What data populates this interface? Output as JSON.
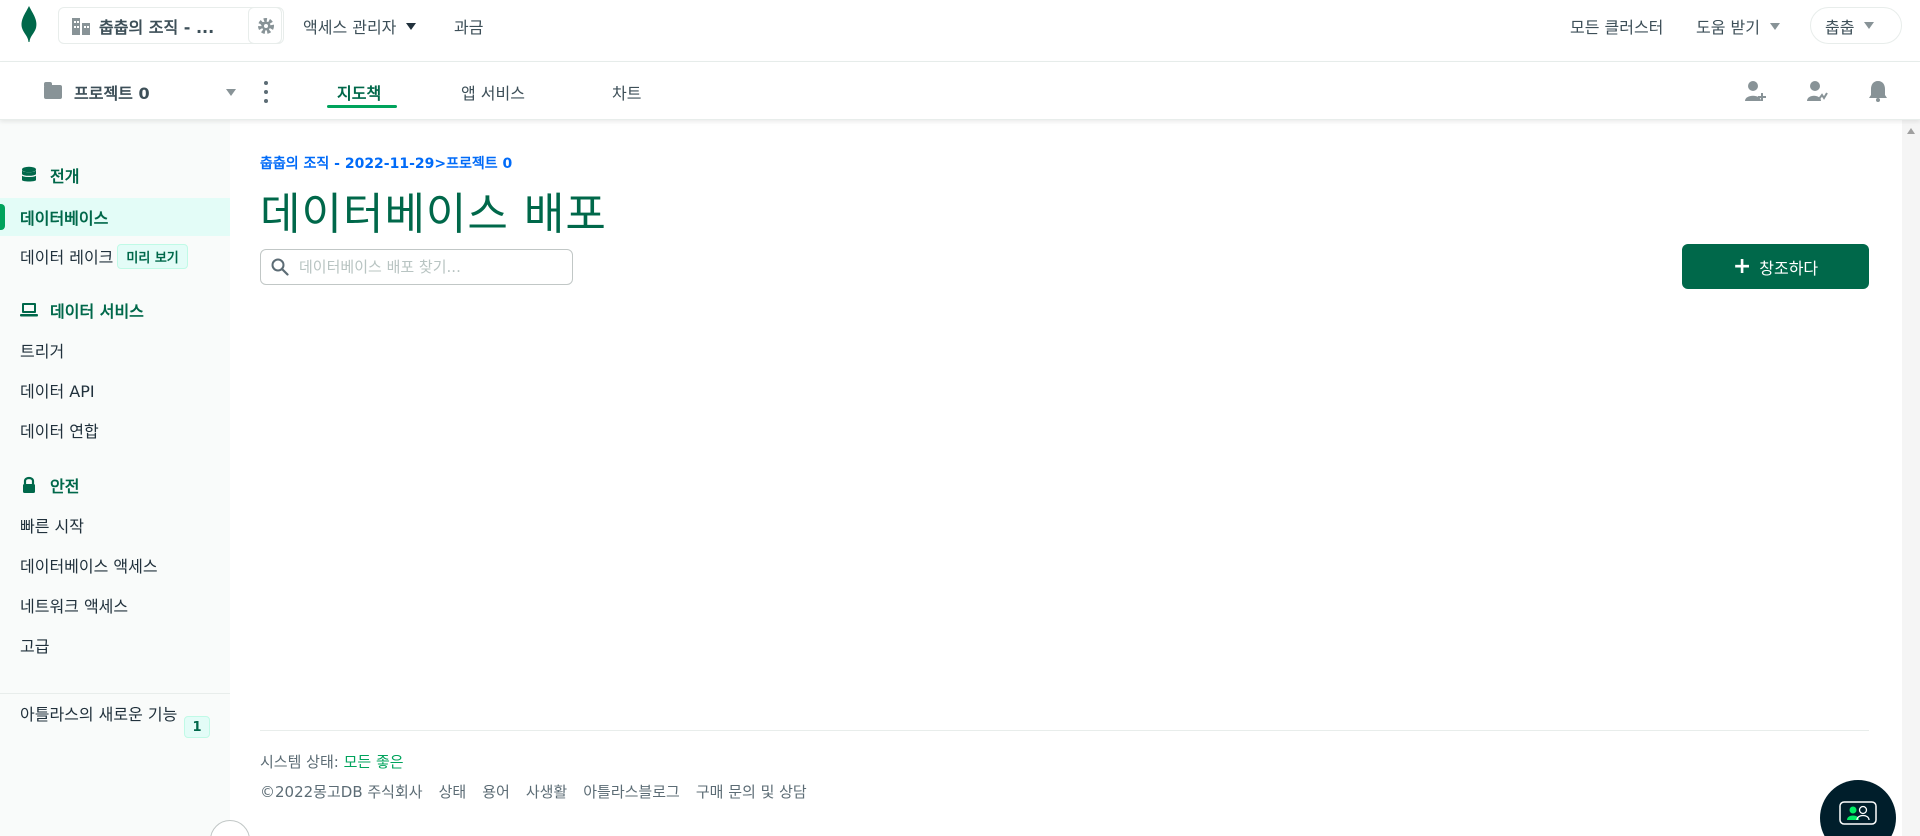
{
  "topbar": {
    "org_name": "춥춥의 조직 - ...",
    "access_manager": "액세스 관리자",
    "billing": "과금",
    "all_clusters": "모든 클러스터",
    "get_help": "도움 받기",
    "user": "춥춥"
  },
  "projectbar": {
    "project_name": "프로젝트 0",
    "tabs": [
      {
        "label": "지도책",
        "active": true
      },
      {
        "label": "앱 서비스",
        "active": false
      },
      {
        "label": "차트",
        "active": false
      }
    ]
  },
  "sidebar": {
    "sections": [
      {
        "title": "전개",
        "icon": "database-icon"
      },
      {
        "title": "데이터 서비스",
        "icon": "laptop-icon"
      },
      {
        "title": "안전",
        "icon": "lock-icon"
      }
    ],
    "items": {
      "databases": "데이터베이스",
      "data_lake": "데이터 레이크",
      "data_lake_badge": "미리 보기",
      "triggers": "트리거",
      "data_api": "데이터 API",
      "data_federation": "데이터 연합",
      "quickstart": "빠른 시작",
      "database_access": "데이터베이스 액세스",
      "network_access": "네트워크 액세스",
      "advanced": "고급"
    },
    "new_features": "아틀라스의 새로운 기능",
    "new_features_count": "1"
  },
  "main": {
    "breadcrumb": "춥춥의 조직 - 2022-11-29>프로젝트 0",
    "title": "데이터베이스 배포",
    "search_placeholder": "데이터베이스 배포 찾기...",
    "create_button": "창조하다"
  },
  "footer": {
    "status_label": "시스템 상태: ",
    "status_value": "모든 좋은",
    "links": [
      "©2022몽고DB 주식회사",
      "상태",
      "용어",
      "사생활",
      "아틀라스블로그",
      "구매 문의 및 상담"
    ]
  },
  "colors": {
    "brand_green": "#00684a",
    "accent_green": "#00a35c",
    "link_blue": "#016bf8"
  }
}
